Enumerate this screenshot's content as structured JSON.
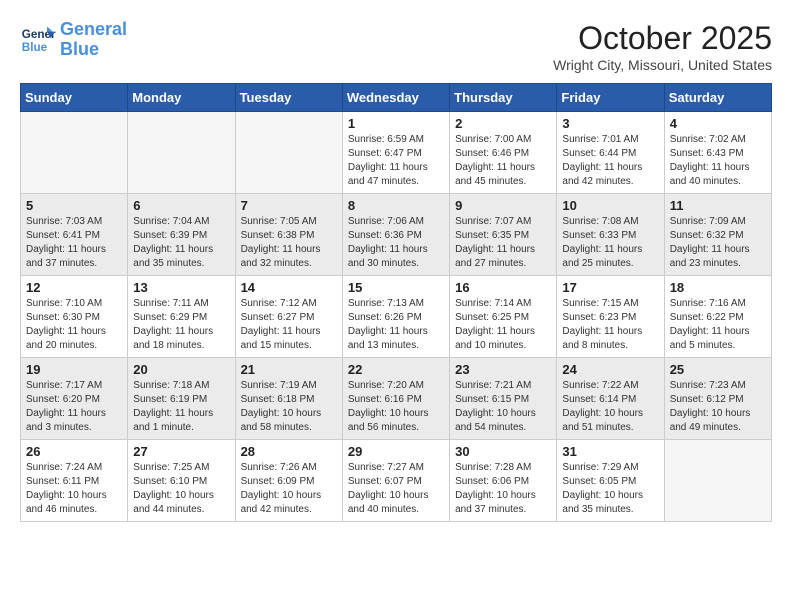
{
  "logo": {
    "line1": "General",
    "line2": "Blue"
  },
  "title": "October 2025",
  "location": "Wright City, Missouri, United States",
  "days_of_week": [
    "Sunday",
    "Monday",
    "Tuesday",
    "Wednesday",
    "Thursday",
    "Friday",
    "Saturday"
  ],
  "weeks": [
    {
      "shaded": false,
      "days": [
        {
          "number": "",
          "info": ""
        },
        {
          "number": "",
          "info": ""
        },
        {
          "number": "",
          "info": ""
        },
        {
          "number": "1",
          "info": "Sunrise: 6:59 AM\nSunset: 6:47 PM\nDaylight: 11 hours\nand 47 minutes."
        },
        {
          "number": "2",
          "info": "Sunrise: 7:00 AM\nSunset: 6:46 PM\nDaylight: 11 hours\nand 45 minutes."
        },
        {
          "number": "3",
          "info": "Sunrise: 7:01 AM\nSunset: 6:44 PM\nDaylight: 11 hours\nand 42 minutes."
        },
        {
          "number": "4",
          "info": "Sunrise: 7:02 AM\nSunset: 6:43 PM\nDaylight: 11 hours\nand 40 minutes."
        }
      ]
    },
    {
      "shaded": true,
      "days": [
        {
          "number": "5",
          "info": "Sunrise: 7:03 AM\nSunset: 6:41 PM\nDaylight: 11 hours\nand 37 minutes."
        },
        {
          "number": "6",
          "info": "Sunrise: 7:04 AM\nSunset: 6:39 PM\nDaylight: 11 hours\nand 35 minutes."
        },
        {
          "number": "7",
          "info": "Sunrise: 7:05 AM\nSunset: 6:38 PM\nDaylight: 11 hours\nand 32 minutes."
        },
        {
          "number": "8",
          "info": "Sunrise: 7:06 AM\nSunset: 6:36 PM\nDaylight: 11 hours\nand 30 minutes."
        },
        {
          "number": "9",
          "info": "Sunrise: 7:07 AM\nSunset: 6:35 PM\nDaylight: 11 hours\nand 27 minutes."
        },
        {
          "number": "10",
          "info": "Sunrise: 7:08 AM\nSunset: 6:33 PM\nDaylight: 11 hours\nand 25 minutes."
        },
        {
          "number": "11",
          "info": "Sunrise: 7:09 AM\nSunset: 6:32 PM\nDaylight: 11 hours\nand 23 minutes."
        }
      ]
    },
    {
      "shaded": false,
      "days": [
        {
          "number": "12",
          "info": "Sunrise: 7:10 AM\nSunset: 6:30 PM\nDaylight: 11 hours\nand 20 minutes."
        },
        {
          "number": "13",
          "info": "Sunrise: 7:11 AM\nSunset: 6:29 PM\nDaylight: 11 hours\nand 18 minutes."
        },
        {
          "number": "14",
          "info": "Sunrise: 7:12 AM\nSunset: 6:27 PM\nDaylight: 11 hours\nand 15 minutes."
        },
        {
          "number": "15",
          "info": "Sunrise: 7:13 AM\nSunset: 6:26 PM\nDaylight: 11 hours\nand 13 minutes."
        },
        {
          "number": "16",
          "info": "Sunrise: 7:14 AM\nSunset: 6:25 PM\nDaylight: 11 hours\nand 10 minutes."
        },
        {
          "number": "17",
          "info": "Sunrise: 7:15 AM\nSunset: 6:23 PM\nDaylight: 11 hours\nand 8 minutes."
        },
        {
          "number": "18",
          "info": "Sunrise: 7:16 AM\nSunset: 6:22 PM\nDaylight: 11 hours\nand 5 minutes."
        }
      ]
    },
    {
      "shaded": true,
      "days": [
        {
          "number": "19",
          "info": "Sunrise: 7:17 AM\nSunset: 6:20 PM\nDaylight: 11 hours\nand 3 minutes."
        },
        {
          "number": "20",
          "info": "Sunrise: 7:18 AM\nSunset: 6:19 PM\nDaylight: 11 hours\nand 1 minute."
        },
        {
          "number": "21",
          "info": "Sunrise: 7:19 AM\nSunset: 6:18 PM\nDaylight: 10 hours\nand 58 minutes."
        },
        {
          "number": "22",
          "info": "Sunrise: 7:20 AM\nSunset: 6:16 PM\nDaylight: 10 hours\nand 56 minutes."
        },
        {
          "number": "23",
          "info": "Sunrise: 7:21 AM\nSunset: 6:15 PM\nDaylight: 10 hours\nand 54 minutes."
        },
        {
          "number": "24",
          "info": "Sunrise: 7:22 AM\nSunset: 6:14 PM\nDaylight: 10 hours\nand 51 minutes."
        },
        {
          "number": "25",
          "info": "Sunrise: 7:23 AM\nSunset: 6:12 PM\nDaylight: 10 hours\nand 49 minutes."
        }
      ]
    },
    {
      "shaded": false,
      "days": [
        {
          "number": "26",
          "info": "Sunrise: 7:24 AM\nSunset: 6:11 PM\nDaylight: 10 hours\nand 46 minutes."
        },
        {
          "number": "27",
          "info": "Sunrise: 7:25 AM\nSunset: 6:10 PM\nDaylight: 10 hours\nand 44 minutes."
        },
        {
          "number": "28",
          "info": "Sunrise: 7:26 AM\nSunset: 6:09 PM\nDaylight: 10 hours\nand 42 minutes."
        },
        {
          "number": "29",
          "info": "Sunrise: 7:27 AM\nSunset: 6:07 PM\nDaylight: 10 hours\nand 40 minutes."
        },
        {
          "number": "30",
          "info": "Sunrise: 7:28 AM\nSunset: 6:06 PM\nDaylight: 10 hours\nand 37 minutes."
        },
        {
          "number": "31",
          "info": "Sunrise: 7:29 AM\nSunset: 6:05 PM\nDaylight: 10 hours\nand 35 minutes."
        },
        {
          "number": "",
          "info": ""
        }
      ]
    }
  ]
}
